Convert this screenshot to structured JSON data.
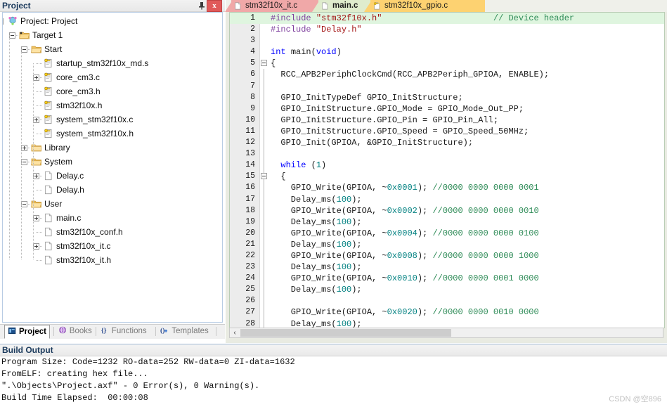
{
  "project_pane": {
    "title": "Project",
    "pin_icon": "pin-icon",
    "close_label": "x",
    "tree": [
      {
        "depth": 0,
        "label": "Project: Project",
        "icon": "project-icon",
        "toggle": "minus"
      },
      {
        "depth": 1,
        "label": "Target 1",
        "icon": "target-folder-icon",
        "toggle": "minus"
      },
      {
        "depth": 2,
        "label": "Start",
        "icon": "folder-open-icon",
        "toggle": "minus"
      },
      {
        "depth": 3,
        "label": "startup_stm32f10x_md.s",
        "icon": "source-key-icon",
        "toggle": "none"
      },
      {
        "depth": 3,
        "label": "core_cm3.c",
        "icon": "source-key-icon",
        "toggle": "plus"
      },
      {
        "depth": 3,
        "label": "core_cm3.h",
        "icon": "source-key-icon",
        "toggle": "none"
      },
      {
        "depth": 3,
        "label": "stm32f10x.h",
        "icon": "source-key-icon",
        "toggle": "none"
      },
      {
        "depth": 3,
        "label": "system_stm32f10x.c",
        "icon": "source-key-icon",
        "toggle": "plus"
      },
      {
        "depth": 3,
        "label": "system_stm32f10x.h",
        "icon": "source-key-icon",
        "toggle": "none"
      },
      {
        "depth": 2,
        "label": "Library",
        "icon": "folder-closed-icon",
        "toggle": "plus"
      },
      {
        "depth": 2,
        "label": "System",
        "icon": "folder-open-icon",
        "toggle": "minus"
      },
      {
        "depth": 3,
        "label": "Delay.c",
        "icon": "file-icon",
        "toggle": "plus"
      },
      {
        "depth": 3,
        "label": "Delay.h",
        "icon": "file-icon",
        "toggle": "none"
      },
      {
        "depth": 2,
        "label": "User",
        "icon": "folder-open-icon",
        "toggle": "minus"
      },
      {
        "depth": 3,
        "label": "main.c",
        "icon": "file-icon",
        "toggle": "plus"
      },
      {
        "depth": 3,
        "label": "stm32f10x_conf.h",
        "icon": "file-icon",
        "toggle": "none"
      },
      {
        "depth": 3,
        "label": "stm32f10x_it.c",
        "icon": "file-icon",
        "toggle": "plus"
      },
      {
        "depth": 3,
        "label": "stm32f10x_it.h",
        "icon": "file-icon",
        "toggle": "none"
      }
    ],
    "view_tabs": [
      {
        "label": "Project",
        "icon": "project-window-icon",
        "active": true
      },
      {
        "label": "Books",
        "icon": "books-icon",
        "active": false
      },
      {
        "label": "Functions",
        "icon": "functions-icon",
        "active": false
      },
      {
        "label": "Templates",
        "icon": "templates-icon",
        "active": false
      }
    ]
  },
  "editor": {
    "tabs": [
      {
        "label": "stm32f10x_it.c",
        "color": "#f0a8a8",
        "active": false,
        "icon": "file-icon"
      },
      {
        "label": "main.c",
        "color": "#dfeccd",
        "active": true,
        "icon": "file-icon"
      },
      {
        "label": "stm32f10x_gpio.c",
        "color": "#fdd271",
        "active": false,
        "icon": "file-key-icon"
      }
    ],
    "scrollbar": {
      "left_arrow": "‹"
    },
    "lines": [
      {
        "n": "1",
        "fold": "none",
        "bar": false,
        "hl": true,
        "parts": [
          {
            "t": "#include ",
            "c": "pp"
          },
          {
            "t": "\"stm32f10x.h\"",
            "c": "str"
          },
          {
            "t": "                      ",
            "c": "pl"
          },
          {
            "t": "// Device header",
            "c": "cm"
          }
        ]
      },
      {
        "n": "2",
        "fold": "none",
        "bar": false,
        "hl": false,
        "parts": [
          {
            "t": "#include ",
            "c": "pp"
          },
          {
            "t": "\"Delay.h\"",
            "c": "str"
          }
        ]
      },
      {
        "n": "3",
        "fold": "none",
        "bar": false,
        "hl": false,
        "parts": []
      },
      {
        "n": "4",
        "fold": "none",
        "bar": false,
        "hl": false,
        "parts": [
          {
            "t": "int ",
            "c": "k"
          },
          {
            "t": "main(",
            "c": "pl"
          },
          {
            "t": "void",
            "c": "k"
          },
          {
            "t": ")",
            "c": "pl"
          }
        ]
      },
      {
        "n": "5",
        "fold": "minus",
        "bar": false,
        "hl": false,
        "parts": [
          {
            "t": "{",
            "c": "pl"
          }
        ]
      },
      {
        "n": "6",
        "fold": "none",
        "bar": true,
        "hl": false,
        "parts": [
          {
            "t": "  RCC_APB2PeriphClockCmd(RCC_APB2Periph_GPIOA, ENABLE);",
            "c": "pl"
          }
        ]
      },
      {
        "n": "7",
        "fold": "none",
        "bar": true,
        "hl": false,
        "parts": []
      },
      {
        "n": "8",
        "fold": "none",
        "bar": true,
        "hl": false,
        "parts": [
          {
            "t": "  GPIO_InitTypeDef GPIO_InitStructure;",
            "c": "pl"
          }
        ]
      },
      {
        "n": "9",
        "fold": "none",
        "bar": true,
        "hl": false,
        "parts": [
          {
            "t": "  GPIO_InitStructure.GPIO_Mode = GPIO_Mode_Out_PP;",
            "c": "pl"
          }
        ]
      },
      {
        "n": "10",
        "fold": "none",
        "bar": true,
        "hl": false,
        "parts": [
          {
            "t": "  GPIO_InitStructure.GPIO_Pin = GPIO_Pin_All;",
            "c": "pl"
          }
        ]
      },
      {
        "n": "11",
        "fold": "none",
        "bar": true,
        "hl": false,
        "parts": [
          {
            "t": "  GPIO_InitStructure.GPIO_Speed = GPIO_Speed_50MHz;",
            "c": "pl"
          }
        ]
      },
      {
        "n": "12",
        "fold": "none",
        "bar": true,
        "hl": false,
        "parts": [
          {
            "t": "  GPIO_Init(GPIOA, &GPIO_InitStructure);",
            "c": "pl"
          }
        ]
      },
      {
        "n": "13",
        "fold": "none",
        "bar": true,
        "hl": false,
        "parts": []
      },
      {
        "n": "14",
        "fold": "none",
        "bar": true,
        "hl": false,
        "parts": [
          {
            "t": "  ",
            "c": "pl"
          },
          {
            "t": "while",
            "c": "k"
          },
          {
            "t": " (",
            "c": "pl"
          },
          {
            "t": "1",
            "c": "num2"
          },
          {
            "t": ")",
            "c": "pl"
          }
        ]
      },
      {
        "n": "15",
        "fold": "minus",
        "bar": true,
        "hl": false,
        "parts": [
          {
            "t": "  {",
            "c": "pl"
          }
        ]
      },
      {
        "n": "16",
        "fold": "none",
        "bar": true,
        "hl": false,
        "parts": [
          {
            "t": "    GPIO_Write(GPIOA, ~",
            "c": "pl"
          },
          {
            "t": "0x0001",
            "c": "num2"
          },
          {
            "t": "); ",
            "c": "pl"
          },
          {
            "t": "//0000 0000 0000 0001",
            "c": "cm"
          }
        ]
      },
      {
        "n": "17",
        "fold": "none",
        "bar": true,
        "hl": false,
        "parts": [
          {
            "t": "    Delay_ms(",
            "c": "pl"
          },
          {
            "t": "100",
            "c": "num2"
          },
          {
            "t": ");",
            "c": "pl"
          }
        ]
      },
      {
        "n": "18",
        "fold": "none",
        "bar": true,
        "hl": false,
        "parts": [
          {
            "t": "    GPIO_Write(GPIOA, ~",
            "c": "pl"
          },
          {
            "t": "0x0002",
            "c": "num2"
          },
          {
            "t": "); ",
            "c": "pl"
          },
          {
            "t": "//0000 0000 0000 0010",
            "c": "cm"
          }
        ]
      },
      {
        "n": "19",
        "fold": "none",
        "bar": true,
        "hl": false,
        "parts": [
          {
            "t": "    Delay_ms(",
            "c": "pl"
          },
          {
            "t": "100",
            "c": "num2"
          },
          {
            "t": ");",
            "c": "pl"
          }
        ]
      },
      {
        "n": "20",
        "fold": "none",
        "bar": true,
        "hl": false,
        "parts": [
          {
            "t": "    GPIO_Write(GPIOA, ~",
            "c": "pl"
          },
          {
            "t": "0x0004",
            "c": "num2"
          },
          {
            "t": "); ",
            "c": "pl"
          },
          {
            "t": "//0000 0000 0000 0100",
            "c": "cm"
          }
        ]
      },
      {
        "n": "21",
        "fold": "none",
        "bar": true,
        "hl": false,
        "parts": [
          {
            "t": "    Delay_ms(",
            "c": "pl"
          },
          {
            "t": "100",
            "c": "num2"
          },
          {
            "t": ");",
            "c": "pl"
          }
        ]
      },
      {
        "n": "22",
        "fold": "none",
        "bar": true,
        "hl": false,
        "parts": [
          {
            "t": "    GPIO_Write(GPIOA, ~",
            "c": "pl"
          },
          {
            "t": "0x0008",
            "c": "num2"
          },
          {
            "t": "); ",
            "c": "pl"
          },
          {
            "t": "//0000 0000 0000 1000",
            "c": "cm"
          }
        ]
      },
      {
        "n": "23",
        "fold": "none",
        "bar": true,
        "hl": false,
        "parts": [
          {
            "t": "    Delay_ms(",
            "c": "pl"
          },
          {
            "t": "100",
            "c": "num2"
          },
          {
            "t": ");",
            "c": "pl"
          }
        ]
      },
      {
        "n": "24",
        "fold": "none",
        "bar": true,
        "hl": false,
        "parts": [
          {
            "t": "    GPIO_Write(GPIOA, ~",
            "c": "pl"
          },
          {
            "t": "0x0010",
            "c": "num2"
          },
          {
            "t": "); ",
            "c": "pl"
          },
          {
            "t": "//0000 0000 0001 0000",
            "c": "cm"
          }
        ]
      },
      {
        "n": "25",
        "fold": "none",
        "bar": true,
        "hl": false,
        "parts": [
          {
            "t": "    Delay_ms(",
            "c": "pl"
          },
          {
            "t": "100",
            "c": "num2"
          },
          {
            "t": ");",
            "c": "pl"
          }
        ]
      },
      {
        "n": "26",
        "fold": "none",
        "bar": true,
        "hl": false,
        "parts": []
      },
      {
        "n": "27",
        "fold": "none",
        "bar": true,
        "hl": false,
        "parts": [
          {
            "t": "    GPIO_Write(GPIOA, ~",
            "c": "pl"
          },
          {
            "t": "0x0020",
            "c": "num2"
          },
          {
            "t": "); ",
            "c": "pl"
          },
          {
            "t": "//0000 0000 0010 0000",
            "c": "cm"
          }
        ]
      },
      {
        "n": "28",
        "fold": "none",
        "bar": true,
        "hl": false,
        "parts": [
          {
            "t": "    Delay_ms(",
            "c": "pl"
          },
          {
            "t": "100",
            "c": "num2"
          },
          {
            "t": ");",
            "c": "pl"
          }
        ]
      }
    ]
  },
  "build_output": {
    "title": "Build Output",
    "lines": [
      "Program Size: Code=1232 RO-data=252 RW-data=0 ZI-data=1632",
      "FromELF: creating hex file...",
      "\".\\Objects\\Project.axf\" - 0 Error(s), 0 Warning(s).",
      "Build Time Elapsed:  00:00:08"
    ]
  },
  "watermark": "CSDN @空896",
  "colors": {
    "accent_blue": "#1b3a5c",
    "close_red": "#e05a5a",
    "tab_it_c": "#f0a8a8",
    "tab_main_c": "#dfeccd",
    "tab_gpio_c": "#fdd271",
    "highlight_green": "#dff5df",
    "comment_green": "#2e8b57",
    "number_teal": "#008080",
    "keyword_blue": "#0000ff"
  }
}
